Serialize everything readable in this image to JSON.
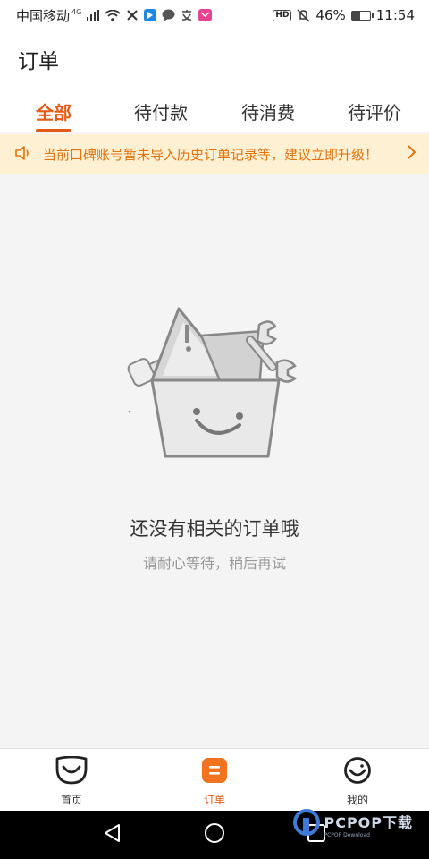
{
  "status_bar": {
    "carrier": "中国移动",
    "network": "4G",
    "battery_percent": "46%",
    "battery_level": 0.46,
    "time": "11:54",
    "hd_label": "HD"
  },
  "header": {
    "title": "订单"
  },
  "tabs": [
    {
      "label": "全部",
      "active": true
    },
    {
      "label": "待付款",
      "active": false
    },
    {
      "label": "待消费",
      "active": false
    },
    {
      "label": "待评价",
      "active": false
    }
  ],
  "notice": {
    "text": "当前口碑账号暂未导入历史订单记录等，建议立即升级！",
    "icon": "speaker-icon"
  },
  "empty_state": {
    "title": "还没有相关的订单哦",
    "subtitle": "请耐心等待，稍后再试",
    "illustration": "toolbox-illustration"
  },
  "bottom_nav": [
    {
      "label": "首页",
      "icon": "home-face-icon",
      "active": false
    },
    {
      "label": "订单",
      "icon": "order-icon",
      "active": true
    },
    {
      "label": "我的",
      "icon": "profile-icon",
      "active": false
    }
  ],
  "watermark": {
    "text": "PCPOP下载",
    "sub": "PCPOP Download"
  },
  "colors": {
    "accent": "#e55a13",
    "notice_bg": "#fdf0d3",
    "notice_text": "#e07410"
  }
}
